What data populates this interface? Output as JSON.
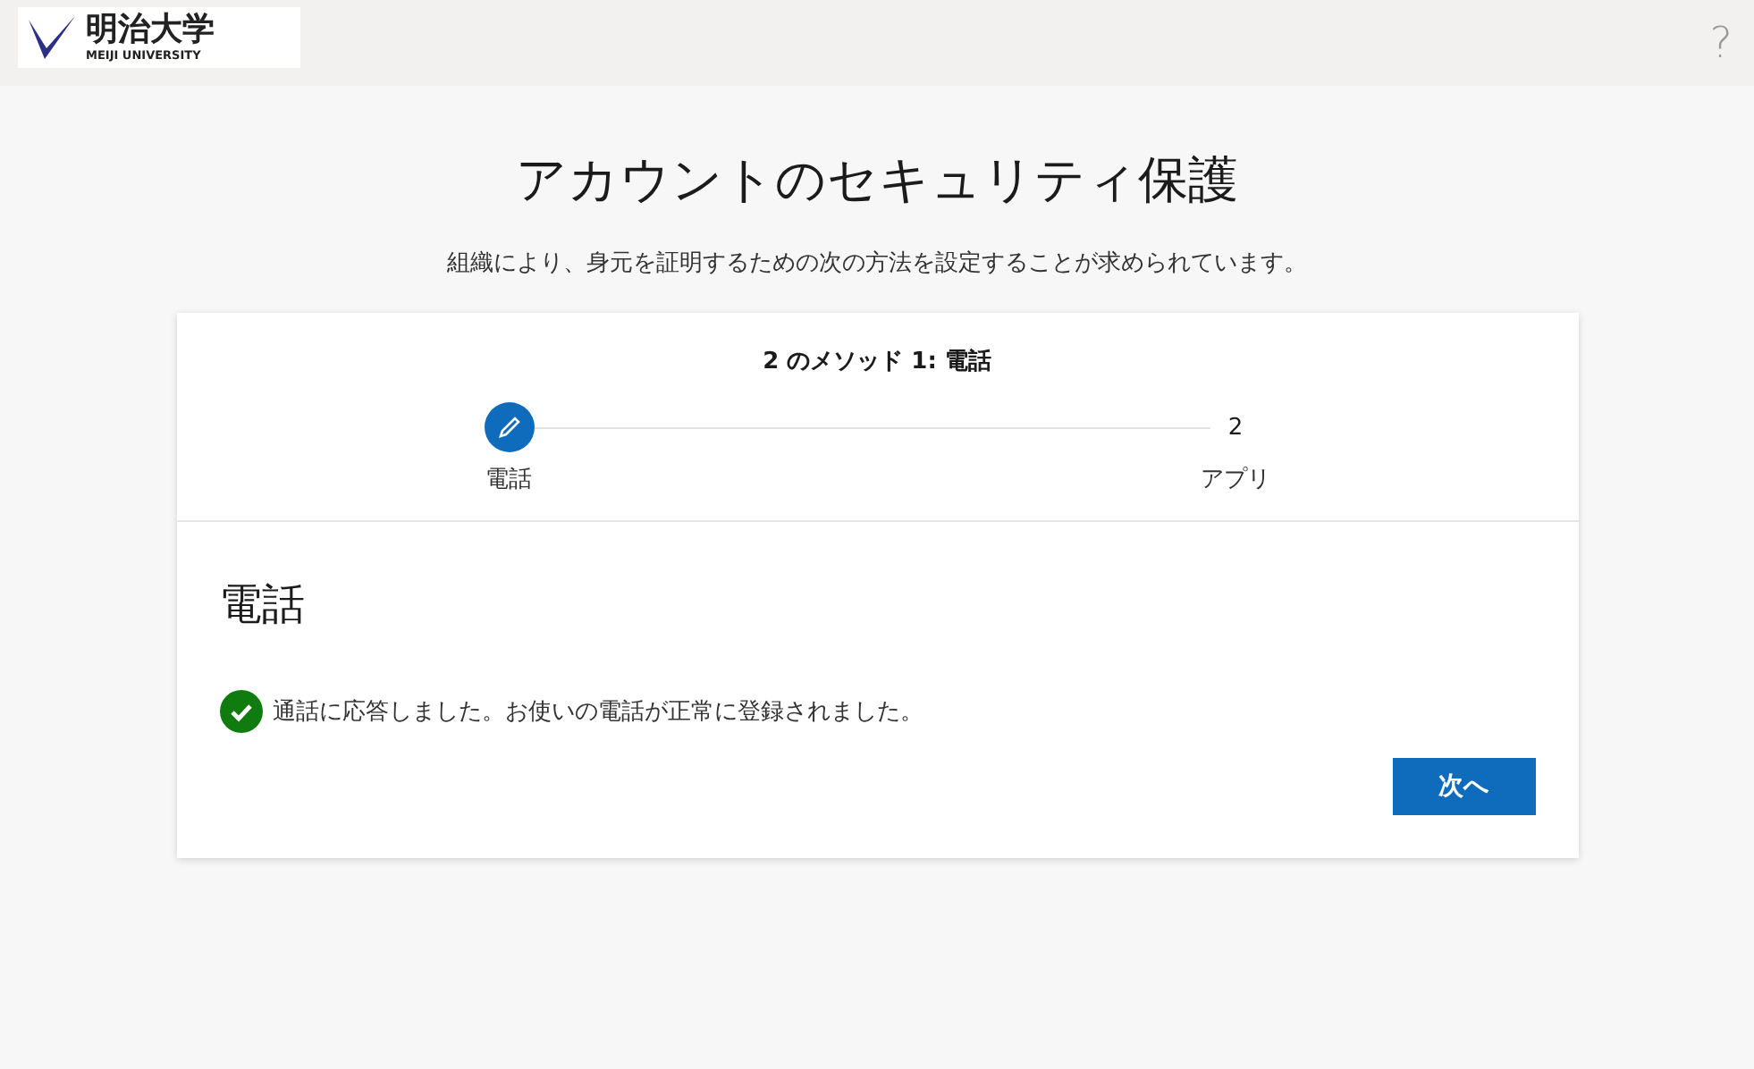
{
  "header": {
    "logo": {
      "name": "明治大学",
      "subtitle": "MEIJI UNIVERSITY"
    },
    "help": "?"
  },
  "title": "アカウントのセキュリティ保護",
  "description": "組織により、身元を証明するための次の方法を設定することが求められています。",
  "card": {
    "progress_title": "2 のメソッド 1: 電話",
    "steps": [
      {
        "label": "電話",
        "selected": true
      },
      {
        "label": "アプリ",
        "number": "2",
        "selected": false
      }
    ],
    "section_title": "電話",
    "status": {
      "kind": "success",
      "message": "通話に応答しました。お使いの電話が正常に登録されました。"
    },
    "button": "次へ"
  }
}
